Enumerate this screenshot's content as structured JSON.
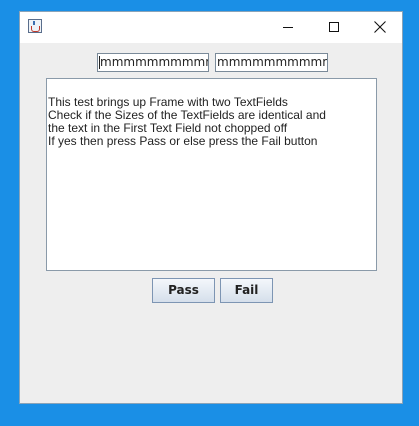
{
  "window": {
    "title": ""
  },
  "titlebar": {
    "icon": "java-cup-icon",
    "controls": [
      "minimize-icon",
      "maximize-icon",
      "close-icon"
    ]
  },
  "fields": {
    "first_value": "mmmmmmmmmmmm",
    "second_value": "mmmmmmmmmmmm"
  },
  "instructions": {
    "lines": [
      "This test brings up Frame with two TextFields",
      "Check if the Sizes of the TextFields are identical and",
      "the text in the First Text Field not chopped off",
      "If yes then press Pass or else press the Fail button"
    ]
  },
  "buttons": {
    "pass_label": "Pass",
    "fail_label": "Fail"
  },
  "colors": {
    "desktop": "#1a8fe6",
    "window_bg": "#eeeeee",
    "titlebar_bg": "#ffffff"
  }
}
